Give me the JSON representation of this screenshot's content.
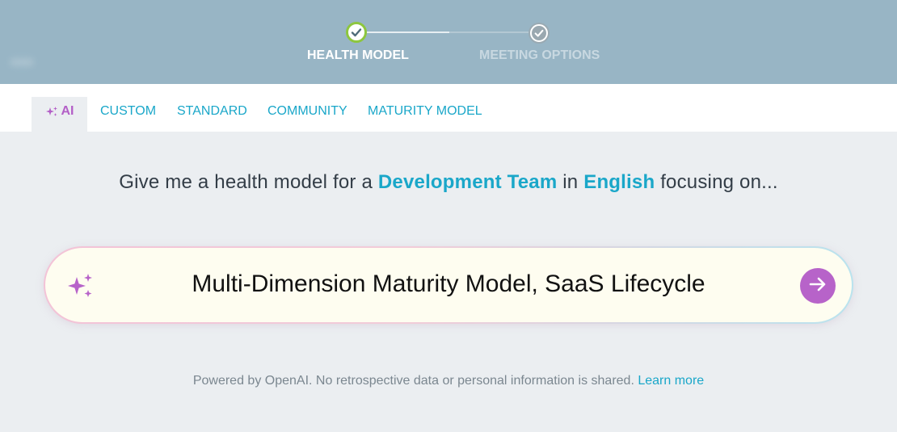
{
  "stepper": {
    "steps": [
      {
        "label": "HEALTH MODEL",
        "state": "complete"
      },
      {
        "label": "MEETING OPTIONS",
        "state": "inactive"
      }
    ],
    "colors": {
      "complete_ring": "#8dc63f",
      "banner_bg": "#98b5c5"
    }
  },
  "tabs": {
    "items": [
      {
        "label": "AI",
        "icon": "sparkle-icon",
        "active": true
      },
      {
        "label": "CUSTOM"
      },
      {
        "label": "STANDARD"
      },
      {
        "label": "COMMUNITY"
      },
      {
        "label": "MATURITY MODEL"
      }
    ]
  },
  "prompt": {
    "prefix": "Give me a health model for a",
    "team_type": "Development Team",
    "connector": "in",
    "language": "English",
    "suffix": "focusing on..."
  },
  "input": {
    "value": "Multi-Dimension Maturity Model, SaaS Lifecycle",
    "icon": "sparkles-icon",
    "submit_icon": "arrow-right-icon"
  },
  "footer": {
    "note": "Powered by OpenAI. No retrospective data or personal information is shared.",
    "link_text": "Learn more"
  },
  "colors": {
    "accent_teal": "#1aa7c9",
    "accent_purple": "#b763c9"
  }
}
